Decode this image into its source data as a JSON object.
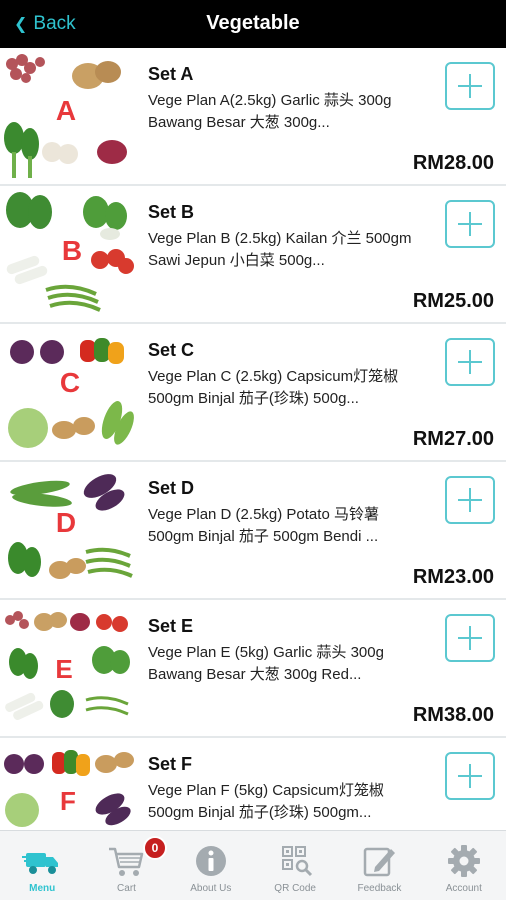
{
  "header": {
    "back_label": "Back",
    "title": "Vegetable"
  },
  "products": [
    {
      "letter": "A",
      "name": "Set A",
      "description": "Vege Plan A(2.5kg) Garlic 蒜头 300g Bawang Besar 大葱 300g...",
      "price": "RM28.00"
    },
    {
      "letter": "B",
      "name": "Set B",
      "description": "Vege Plan B (2.5kg) Kailan 介兰 500gm Sawi Jepun 小白菜 500g...",
      "price": "RM25.00"
    },
    {
      "letter": "C",
      "name": "Set C",
      "description": "Vege Plan C (2.5kg) Capsicum灯笼椒 500gm Binjal 茄子(珍珠) 500g...",
      "price": "RM27.00"
    },
    {
      "letter": "D",
      "name": "Set D",
      "description": "Vege Plan D (2.5kg) Potato 马铃薯 500gm Binjal 茄子 500gm Bendi ...",
      "price": "RM23.00"
    },
    {
      "letter": "E",
      "name": "Set E",
      "description": "Vege Plan E (5kg) Garlic 蒜头 300g Bawang Besar 大葱 300g Red...",
      "price": "RM38.00"
    },
    {
      "letter": "F",
      "name": "Set F",
      "description": "Vege Plan F (5kg) Capsicum灯笼椒 500gm Binjal 茄子(珍珠) 500gm...",
      "price": ""
    }
  ],
  "tabs": [
    {
      "label": "Menu",
      "icon": "delivery-truck-icon",
      "active": true
    },
    {
      "label": "Cart",
      "icon": "cart-icon",
      "active": false
    },
    {
      "label": "About Us",
      "icon": "info-icon",
      "active": false
    },
    {
      "label": "QR Code",
      "icon": "qr-code-icon",
      "active": false
    },
    {
      "label": "Feedback",
      "icon": "edit-icon",
      "active": false
    },
    {
      "label": "Account",
      "icon": "gear-icon",
      "active": false
    }
  ],
  "cart_count": "0",
  "colors": {
    "accent": "#2fc3cf",
    "header_bg": "#000000",
    "badge": "#c62020",
    "letter": "#e8383b"
  }
}
